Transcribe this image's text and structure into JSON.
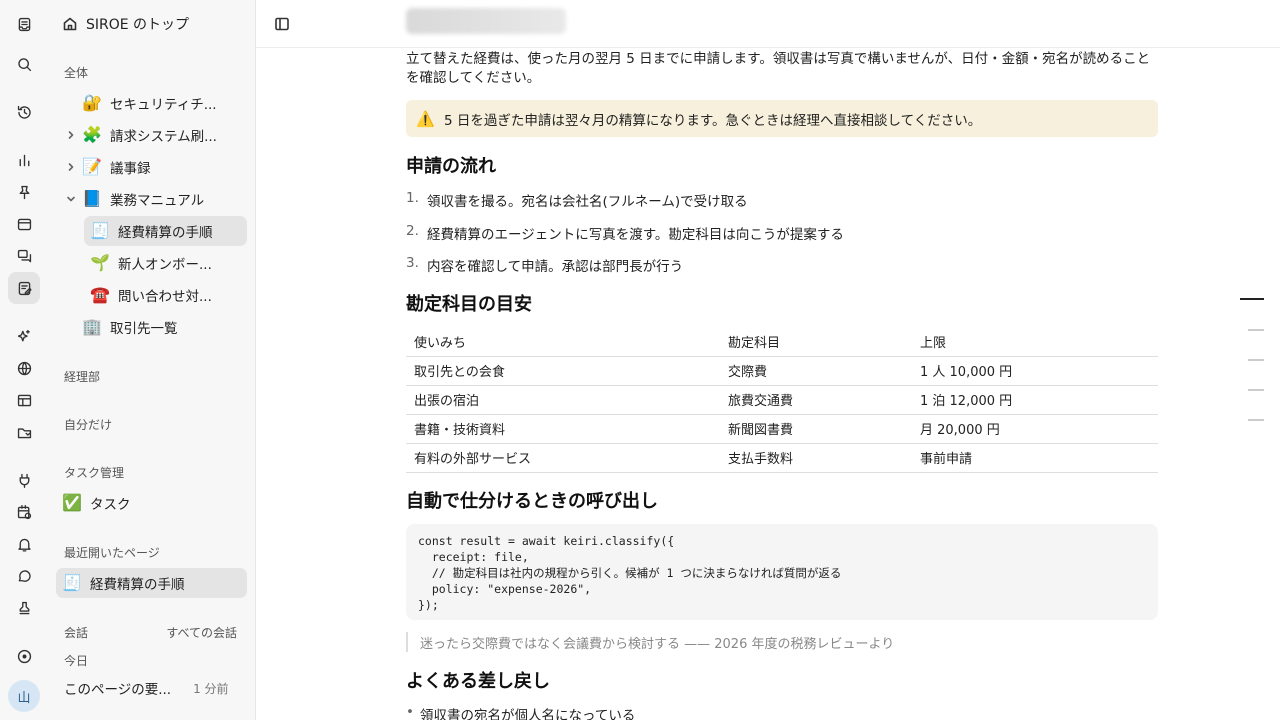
{
  "rail": {
    "icons": [
      "inbox-icon",
      "search-icon",
      "history-icon",
      "chart-icon",
      "pin-icon",
      "window-icon",
      "chat-icon",
      "pages-icon",
      "sparkles-icon",
      "globe-icon",
      "table-icon",
      "folder-sync-icon",
      "plug-icon",
      "calendar-clock-icon",
      "bell-icon",
      "message-icon",
      "stamp-icon",
      "record-icon"
    ],
    "avatar": "山"
  },
  "sidebar": {
    "workspace": "SIROE のトップ",
    "section_all": "全体",
    "tree": [
      {
        "emoji": "🔐",
        "label": "セキュリティチ...",
        "chevron": ""
      },
      {
        "emoji": "🧩",
        "label": "請求システム刷...",
        "chevron": "right"
      },
      {
        "emoji": "📝",
        "label": "議事録",
        "chevron": "right"
      },
      {
        "emoji": "📘",
        "label": "業務マニュアル",
        "chevron": "down"
      },
      {
        "emoji": "🧾",
        "label": "経費精算の手順",
        "chevron": ""
      },
      {
        "emoji": "🌱",
        "label": "新人オンボー...",
        "chevron": ""
      },
      {
        "emoji": "☎️",
        "label": "問い合わせ対...",
        "chevron": ""
      },
      {
        "emoji": "🏢",
        "label": "取引先一覧",
        "chevron": ""
      }
    ],
    "section_dept": "経理部",
    "section_private": "自分だけ",
    "section_tasks": "タスク管理",
    "tasks_item": {
      "emoji": "✅",
      "label": "タスク"
    },
    "section_recent": "最近開いたページ",
    "recent_item": {
      "emoji": "🧾",
      "label": "経費精算の手順"
    },
    "section_conversations": "会話",
    "all_conversations": "すべての会話",
    "today": "今日",
    "conversation": {
      "label": "このページの要...",
      "time": "1 分前"
    }
  },
  "doc": {
    "intro": "立て替えた経費は、使った月の翌月 5 日までに申請します。領収書は写真で構いませんが、日付・金額・宛名が読めることを確認してください。",
    "callout": "5 日を過ぎた申請は翌々月の精算になります。急ぐときは経理へ直接相談してください。",
    "h_flow": "申請の流れ",
    "steps": [
      {
        "n": "1.",
        "text": "領収書を撮る。宛名は会社名(フルネーム)で受け取る"
      },
      {
        "n": "2.",
        "text": "経費精算のエージェントに写真を渡す。勘定科目は向こうが提案する"
      },
      {
        "n": "3.",
        "text": "内容を確認して申請。承認は部門長が行う"
      }
    ],
    "h_accounts": "勘定科目の目安",
    "table": {
      "headers": [
        "使いみち",
        "勘定科目",
        "上限"
      ],
      "rows": [
        [
          "取引先との会食",
          "交際費",
          "1 人 10,000 円"
        ],
        [
          "出張の宿泊",
          "旅費交通費",
          "1 泊 12,000 円"
        ],
        [
          "書籍・技術資料",
          "新聞図書費",
          "月 20,000 円"
        ],
        [
          "有料の外部サービス",
          "支払手数料",
          "事前申請"
        ]
      ]
    },
    "h_auto": "自動で仕分けるときの呼び出し",
    "code": [
      "const result = await keiri.classify({",
      "  receipt: file,",
      "  // 勘定科目は社内の規程から引く。候補が 1 つに決まらなければ質問が返る",
      "  policy: \"expense-2026\",",
      "});"
    ],
    "quote": "迷ったら交際費ではなく会議費から検討する —— 2026 年度の税務レビューより",
    "h_returns": "よくある差し戻し",
    "bullet": "領収書の宛名が個人名になっている"
  },
  "colors": {
    "callout_bg": "#f7f0dc",
    "sidebar_bg": "#f7f7f7",
    "selected_bg": "#e4e4e4"
  }
}
